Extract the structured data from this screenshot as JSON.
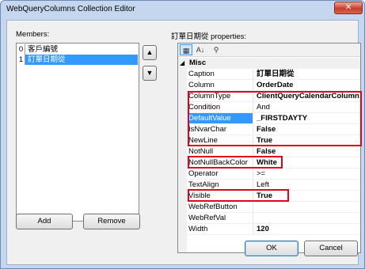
{
  "window": {
    "title": "WebQueryColumns Collection Editor",
    "close_glyph": "✕"
  },
  "members": {
    "label": "Members:",
    "items": [
      {
        "index": "0",
        "name": "客戶編號"
      },
      {
        "index": "1",
        "name": "訂單日期從"
      }
    ],
    "selected_index": 1
  },
  "buttons": {
    "up_glyph": "▲",
    "down_glyph": "▼",
    "add": "Add",
    "remove": "Remove",
    "ok": "OK",
    "cancel": "Cancel"
  },
  "properties": {
    "header": "訂單日期從 properties:",
    "toolbar": {
      "categorized_glyph": "▦",
      "alphabetical_glyph": "A↓",
      "property_pages_glyph": "⚲"
    },
    "category": {
      "toggle": "◢",
      "name": "Misc"
    },
    "rows": [
      {
        "name": "Caption",
        "value": "訂單日期從",
        "bold": true
      },
      {
        "name": "Column",
        "value": "OrderDate",
        "bold": true
      },
      {
        "name": "ColumnType",
        "value": "ClientQueryCalendarColumn",
        "bold": true
      },
      {
        "name": "Condition",
        "value": "And",
        "bold": false
      },
      {
        "name": "DefaultValue",
        "value": "_FIRSTDAYTY",
        "bold": true
      },
      {
        "name": "IsNvarChar",
        "value": "False",
        "bold": true
      },
      {
        "name": "NewLine",
        "value": "True",
        "bold": true
      },
      {
        "name": "NotNull",
        "value": "False",
        "bold": true
      },
      {
        "name": "NotNullBackColor",
        "value": "White",
        "bold": true
      },
      {
        "name": "Operator",
        "value": ">=",
        "bold": false
      },
      {
        "name": "TextAlign",
        "value": "Left",
        "bold": false
      },
      {
        "name": "Visible",
        "value": "True",
        "bold": true
      },
      {
        "name": "WebRefButton",
        "value": "",
        "bold": false
      },
      {
        "name": "WebRefVal",
        "value": "",
        "bold": false
      },
      {
        "name": "Width",
        "value": "120",
        "bold": true
      }
    ],
    "selected_row": 4
  },
  "colors": {
    "highlight_box": "#e2001a",
    "selection": "#3399ff",
    "window_frame": "#c4d7ee"
  }
}
